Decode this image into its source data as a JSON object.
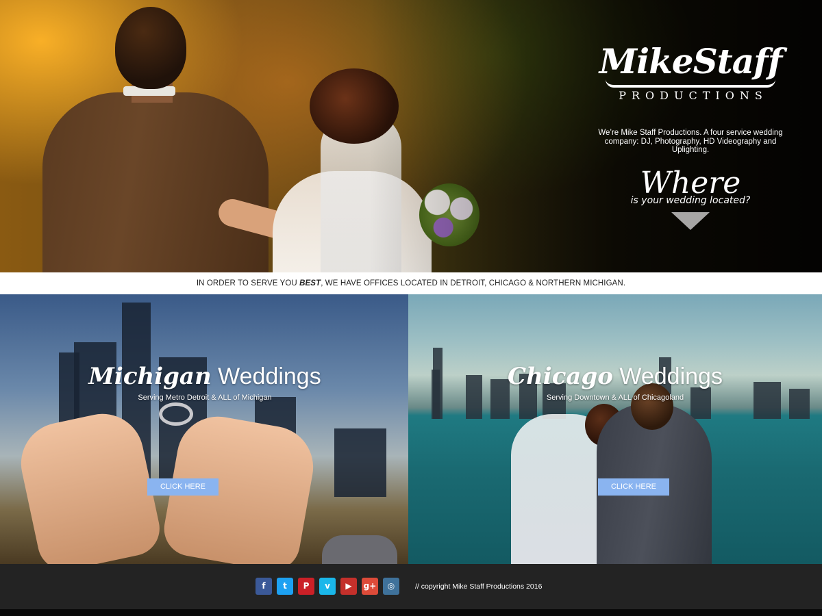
{
  "hero": {
    "logo_main": "MikeStaff",
    "logo_sub": "PRODUCTIONS",
    "intro": "We’re Mike Staff Productions. A four service wedding company: DJ, Photography, HD Videography and Uplighting.",
    "where_title": "Where",
    "where_sub": "is your wedding located?",
    "arrow_icon": "down-triangle-icon"
  },
  "strip": {
    "before": "IN ORDER TO SERVE YOU ",
    "emphasis": "BEST",
    "after": ", WE HAVE OFFICES LOCATED IN DETROIT, CHICAGO & NORTHERN MICHIGAN."
  },
  "panels": [
    {
      "title_script": "Michigan",
      "title_plain": " Weddings",
      "subtitle": "Serving Metro Detroit & ALL of Michigan",
      "cta": "CLICK HERE"
    },
    {
      "title_script": "Chicago",
      "title_plain": " Weddings",
      "subtitle": "Serving Downtown & ALL of Chicagoland",
      "cta": "CLICK HERE"
    }
  ],
  "footer": {
    "social": [
      {
        "name": "facebook-icon",
        "glyph": "f",
        "color": "#3b5998"
      },
      {
        "name": "twitter-icon",
        "glyph": "t",
        "color": "#1da1f2"
      },
      {
        "name": "pinterest-icon",
        "glyph": "P",
        "color": "#cb2027"
      },
      {
        "name": "vimeo-icon",
        "glyph": "v",
        "color": "#1ab7ea"
      },
      {
        "name": "youtube-icon",
        "glyph": "▶",
        "color": "#c4302b"
      },
      {
        "name": "googleplus-icon",
        "glyph": "g+",
        "color": "#dd4b39"
      },
      {
        "name": "instagram-icon",
        "glyph": "◎",
        "color": "#3f729b"
      }
    ],
    "copyright": "// copyright Mike Staff Productions 2016"
  },
  "colors": {
    "cta_bg": "#8ab4f0",
    "footer_bg": "#232323",
    "strip_bg": "#ffffff"
  }
}
